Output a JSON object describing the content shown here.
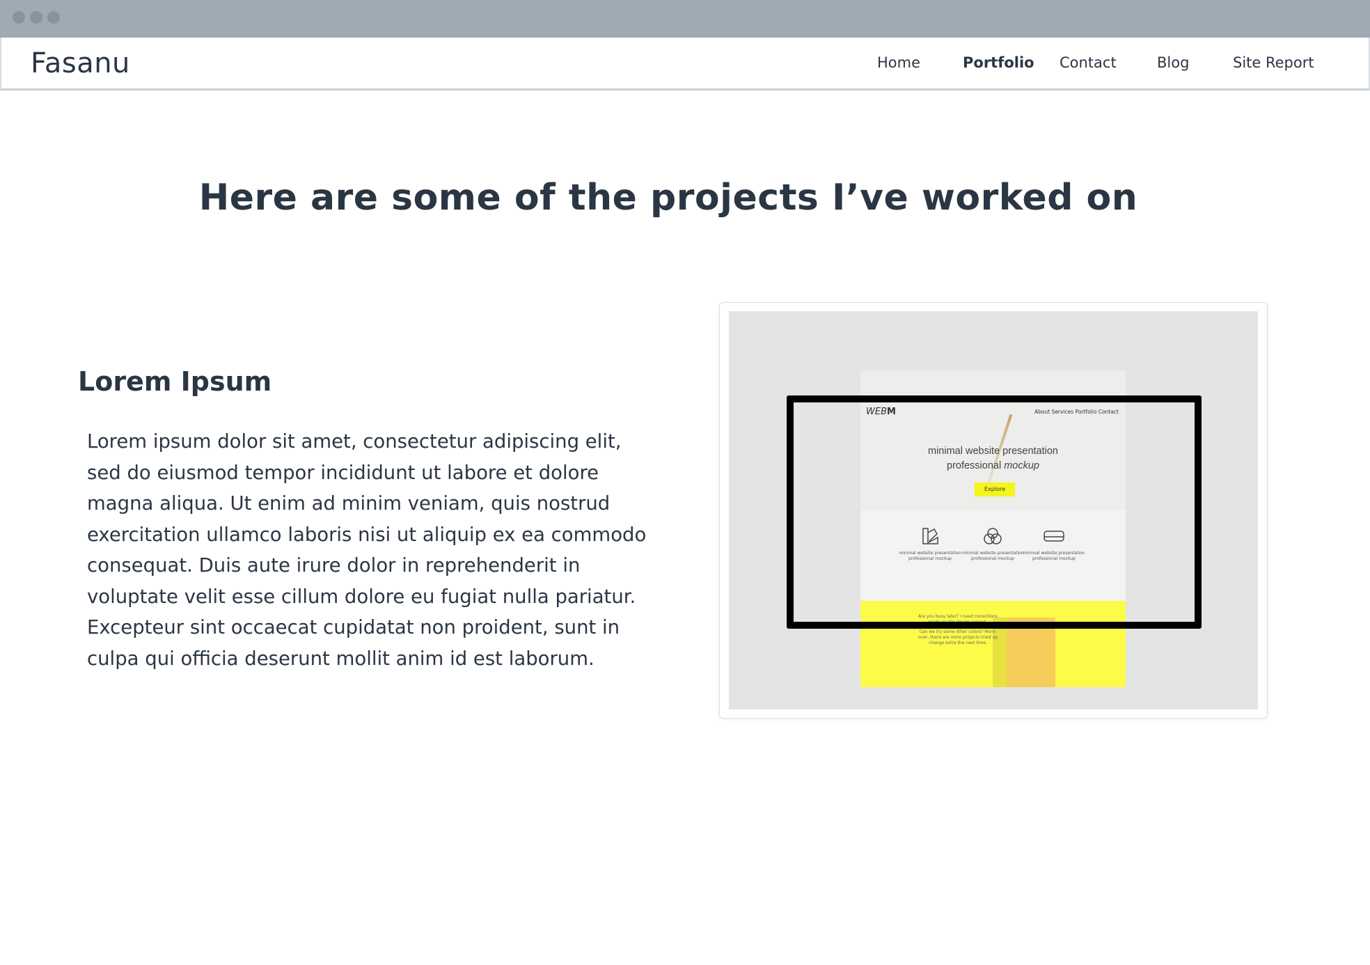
{
  "brand": "Fasanu",
  "nav": {
    "items": [
      {
        "label": "Home"
      },
      {
        "label": "Portfolio",
        "active": true
      },
      {
        "label": "Contact"
      },
      {
        "label": "Blog"
      },
      {
        "label": "Site Report"
      }
    ]
  },
  "headline": "Here are some of the projects I’ve worked on",
  "project": {
    "title": "Lorem Ipsum",
    "description": "Lorem ipsum dolor sit amet, consectetur adipiscing elit, sed do eiusmod tempor incididunt ut labore et dolore magna aliqua. Ut enim ad minim veniam, quis nostrud exercitation ullamco laboris nisi ut aliquip ex ea commodo consequat. Duis aute irure dolor in reprehenderit in voluptate velit esse cillum dolore eu fugiat nulla pariatur. Excepteur sint occaecat cupidatat non proident, sunt in culpa qui officia deserunt mollit anim id est laborum.",
    "mockup": {
      "logo_prefix": "WEB",
      "logo_suffix": "M",
      "menu": "About  Services  Portfolio  Contact",
      "headline_line1": "minimal website presentation",
      "headline_line2_prefix": "professional ",
      "headline_line2_italic": "mockup",
      "button": "Explore",
      "features": [
        {
          "icon": "swatch-icon",
          "line1": "minimal website presentation",
          "line2": "professional mockup"
        },
        {
          "icon": "circles-icon",
          "line1": "minimal website presentation",
          "line2": "professional mockup"
        },
        {
          "icon": "sofa-icon",
          "line1": "minimal website presentation",
          "line2": "professional mockup"
        }
      ],
      "yellow_text_1": "Are you busy later? I need corrections made on the design project.",
      "yellow_text_2": "Can we try some other colors? More- over, there are more projects lined up change extra the next time."
    }
  },
  "colors": {
    "text": "#2b3644",
    "chrome": "#9faab5",
    "accent_yellow": "#fbfb48"
  }
}
